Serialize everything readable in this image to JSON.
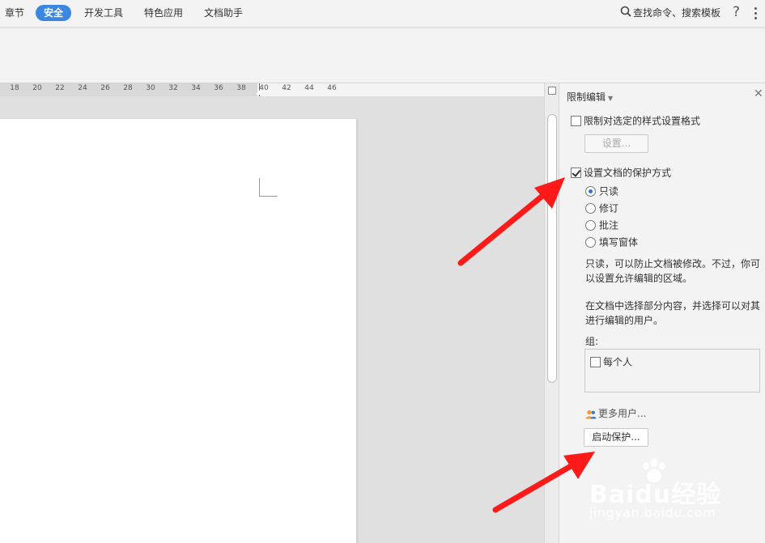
{
  "menu": {
    "tabs": [
      {
        "label": "章节",
        "active": false
      },
      {
        "label": "安全",
        "active": true
      },
      {
        "label": "开发工具",
        "active": false
      },
      {
        "label": "特色应用",
        "active": false
      },
      {
        "label": "文档助手",
        "active": false
      }
    ],
    "search_label": "查找命令、搜索模板",
    "help_label": "?"
  },
  "ruler": {
    "numbers": [
      "18",
      "20",
      "22",
      "24",
      "26",
      "28",
      "30",
      "32",
      "34",
      "36",
      "38",
      "40",
      "42",
      "44",
      "46"
    ]
  },
  "panel": {
    "title": "限制编辑",
    "format_restriction": {
      "label": "限制对选定的样式设置格式",
      "checked": false
    },
    "settings_button": "设置...",
    "protection": {
      "label": "设置文档的保护方式",
      "checked": true
    },
    "modes": [
      {
        "label": "只读",
        "selected": true
      },
      {
        "label": "修订",
        "selected": false
      },
      {
        "label": "批注",
        "selected": false
      },
      {
        "label": "填写窗体",
        "selected": false
      }
    ],
    "description_line1": "只读，可以防止文档被修改。不过，你可",
    "description_line2": "以设置允许编辑的区域。",
    "exception_line1": "在文档中选择部分内容，并选择可以对其",
    "exception_line2": "进行编辑的用户。",
    "group_label": "组:",
    "everyone": {
      "label": "每个人",
      "checked": false
    },
    "more_users": "更多用户...",
    "start_protection_button": "启动保护..."
  },
  "watermark": {
    "brand": "Baidu经验",
    "url": "jingyan.baidu.com"
  },
  "colors": {
    "accent": "#3b86e0",
    "arrow": "#ff1a1a"
  }
}
